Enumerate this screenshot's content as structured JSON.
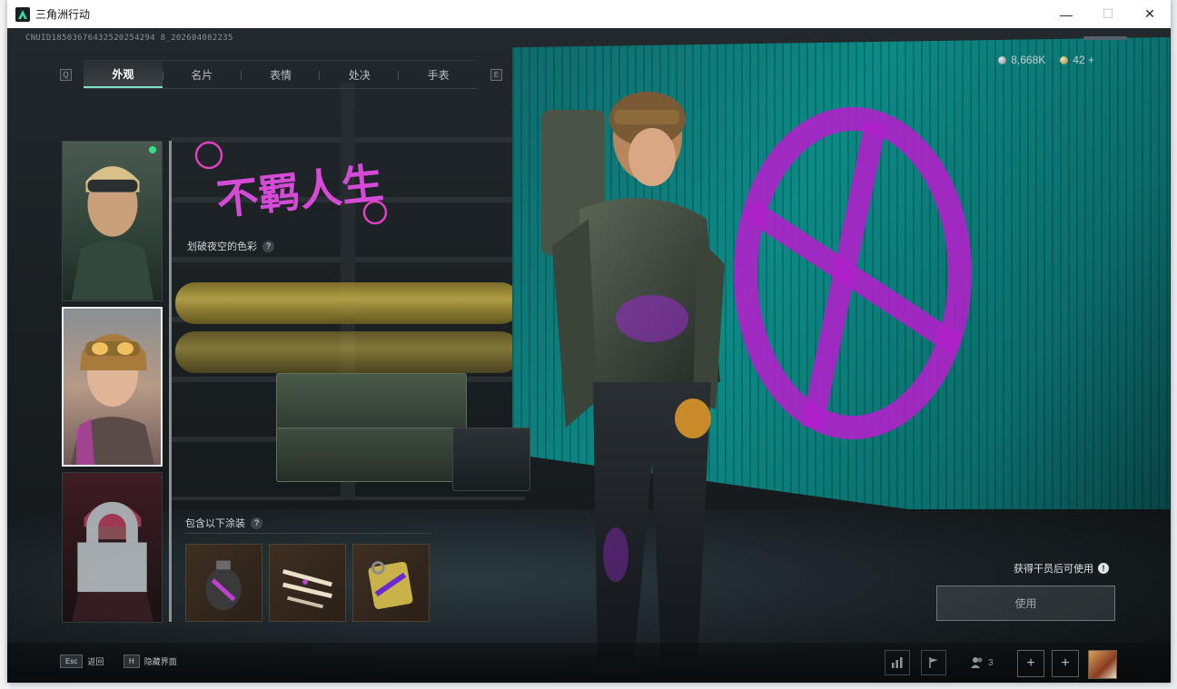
{
  "window": {
    "title": "三角洲行动",
    "controls": {
      "minimize": "—",
      "maximize": "☐",
      "close": "✕"
    }
  },
  "header": {
    "cnuid": "CNUID18503676432520254294 8_202604082235",
    "currency": [
      {
        "icon": "silver-coin-icon",
        "value": "8,668K"
      },
      {
        "icon": "gold-coin-icon",
        "value": "42 +"
      }
    ]
  },
  "tabs": {
    "prev_key": "Q",
    "next_key": "E",
    "items": [
      {
        "label": "外观",
        "active": true
      },
      {
        "label": "名片",
        "active": false
      },
      {
        "label": "表情",
        "active": false
      },
      {
        "label": "处决",
        "active": false
      },
      {
        "label": "手表",
        "active": false
      }
    ]
  },
  "skin": {
    "title_art": "不羁人生",
    "subtitle": "划破夜空的色彩",
    "help_icon": "?",
    "includes_label": "包含以下涂装",
    "unlock_note": "获得干员后可使用",
    "info_icon": "!",
    "use_button": "使用"
  },
  "bottom": {
    "back_key": "Esc",
    "back_label": "返回",
    "hide_key": "H",
    "hide_label": "隐藏界面",
    "team_count": "3",
    "slot1": "+",
    "slot2": "+"
  },
  "colors": {
    "accent": "#7fe3c4",
    "graffiti": "#b021c9",
    "wall": "#0c8a86",
    "online": "#33e08a"
  }
}
